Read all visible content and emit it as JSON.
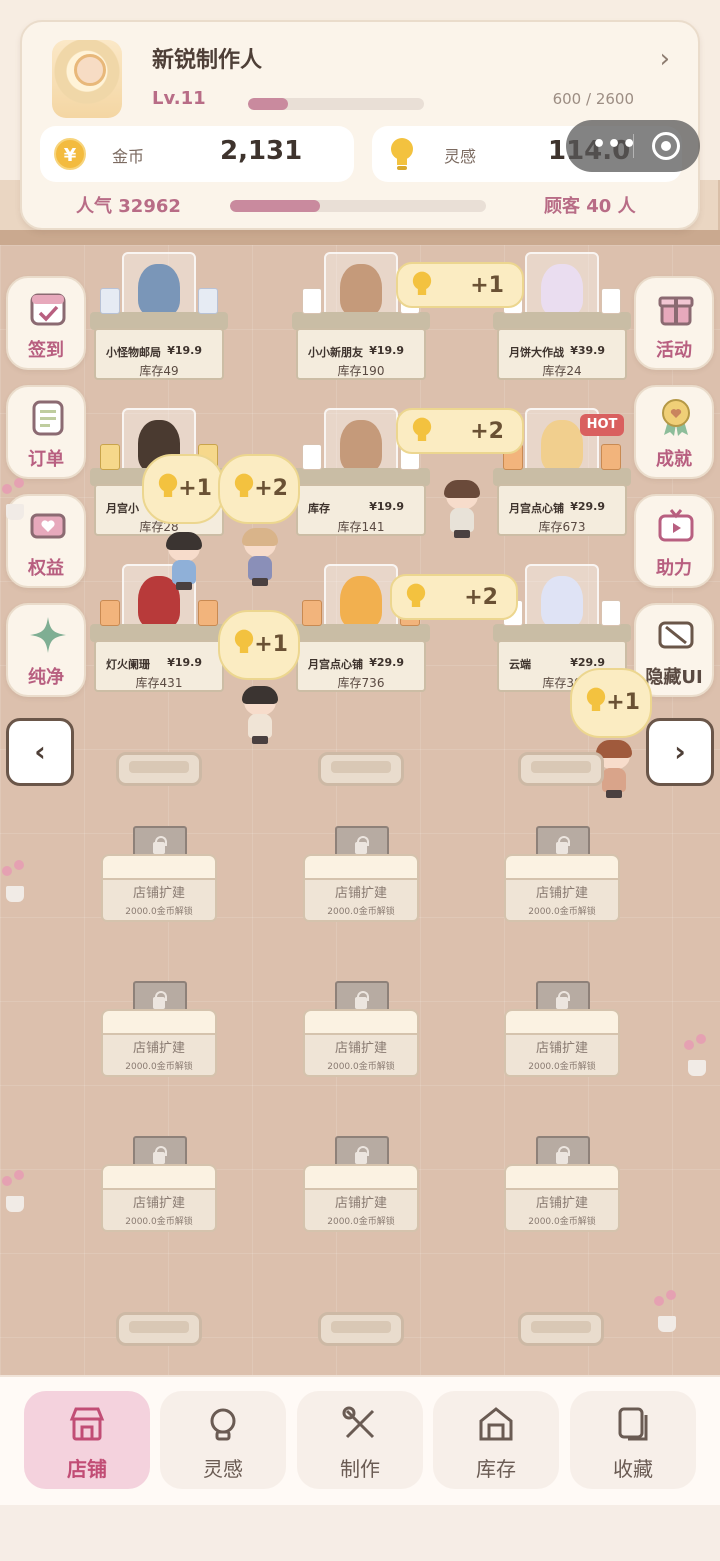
{
  "header": {
    "shop_name": "新锐制作人",
    "level": "Lv.11",
    "exp_text": "600 / 2600",
    "exp_fraction": 0.23,
    "coins_label": "金币",
    "coins_value": "2,131",
    "inspiration_label": "灵感",
    "inspiration_value": "114.0",
    "popularity": "人气 32962",
    "popularity_fraction": 0.35,
    "customers": "顾客 40 人"
  },
  "side_left": [
    {
      "label": "签到",
      "icon": "calendar-check-icon"
    },
    {
      "label": "订单",
      "icon": "order-list-icon"
    },
    {
      "label": "权益",
      "icon": "ticket-heart-icon"
    },
    {
      "label": "纯净",
      "icon": "sparkle-icon"
    }
  ],
  "side_right": [
    {
      "label": "活动",
      "icon": "gift-icon"
    },
    {
      "label": "成就",
      "icon": "medal-icon"
    },
    {
      "label": "助力",
      "icon": "tv-icon"
    },
    {
      "label": "隐藏UI",
      "icon": "hide-ui-icon"
    }
  ],
  "shelves": [
    {
      "name": "小怪物邮局",
      "price": "¥19.9",
      "stock": "库存49"
    },
    {
      "name": "小小新朋友",
      "price": "¥19.9",
      "stock": "库存190"
    },
    {
      "name": "月饼大作战",
      "price": "¥39.9",
      "stock": "库存24"
    },
    {
      "name": "月宫小",
      "price": "",
      "stock": "库存28"
    },
    {
      "name": "库存",
      "price": "¥19.9",
      "stock": "库存141"
    },
    {
      "name": "月宫点心铺",
      "price": "¥29.9",
      "stock": "库存673"
    },
    {
      "name": "灯火阑珊",
      "price": "¥19.9",
      "stock": "库存431"
    },
    {
      "name": "月宫点心铺",
      "price": "¥29.9",
      "stock": "库存736"
    },
    {
      "name": "云端",
      "price": "¥29.9",
      "stock": "库存30"
    }
  ],
  "hot_badge": "HOT",
  "bubbles": [
    "+1",
    "+2",
    "+1",
    "+2",
    "+2",
    "+1",
    "+1"
  ],
  "locked_slot": {
    "title": "店铺扩建",
    "cost": "2000.0金币解锁"
  },
  "nav": {
    "prev": "‹",
    "next": "›"
  },
  "tabs": [
    {
      "label": "店铺",
      "active": true
    },
    {
      "label": "灵感"
    },
    {
      "label": "制作"
    },
    {
      "label": "库存"
    },
    {
      "label": "收藏"
    }
  ],
  "colors": {
    "accent_pink": "#b86c86",
    "bubble_yellow": "#fbecc2",
    "floor": "#dcc0ad"
  }
}
